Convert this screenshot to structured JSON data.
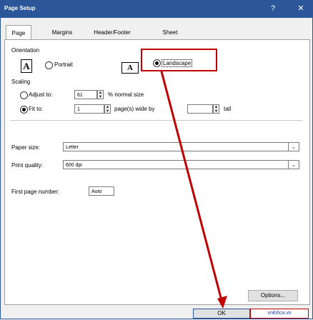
{
  "window": {
    "title": "Page Setup",
    "help_label": "?",
    "close_label": "✕"
  },
  "tabs": [
    {
      "label": "Page"
    },
    {
      "label": "Margins"
    },
    {
      "label": "Header/Footer"
    },
    {
      "label": "Sheet"
    }
  ],
  "orientation": {
    "heading": "Orientation",
    "portrait_label": "Portrait",
    "landscape_label": "Landscape",
    "icon_letter": "A",
    "selected": "Landscape"
  },
  "scaling": {
    "heading": "Scaling",
    "adjust_label": "Adjust to:",
    "adjust_value": "61",
    "adjust_suffix": "% normal size",
    "fit_label": "Fit to:",
    "fit_wide_value": "1",
    "fit_wide_suffix": "page(s) wide by",
    "fit_tall_value": "",
    "fit_tall_suffix": "tall",
    "selected": "Fit to"
  },
  "paper": {
    "size_label": "Paper size:",
    "size_value": "Letter",
    "quality_label": "Print quality:",
    "quality_value": "600 dpi",
    "first_page_label": "First page number:",
    "first_page_value": "Auto"
  },
  "buttons": {
    "options_label": "Options...",
    "ok_label": "OK"
  },
  "watermark": {
    "text": "vnĐôca.vn"
  },
  "colors": {
    "titlebar": "#2b579a",
    "highlight": "#c00000"
  }
}
